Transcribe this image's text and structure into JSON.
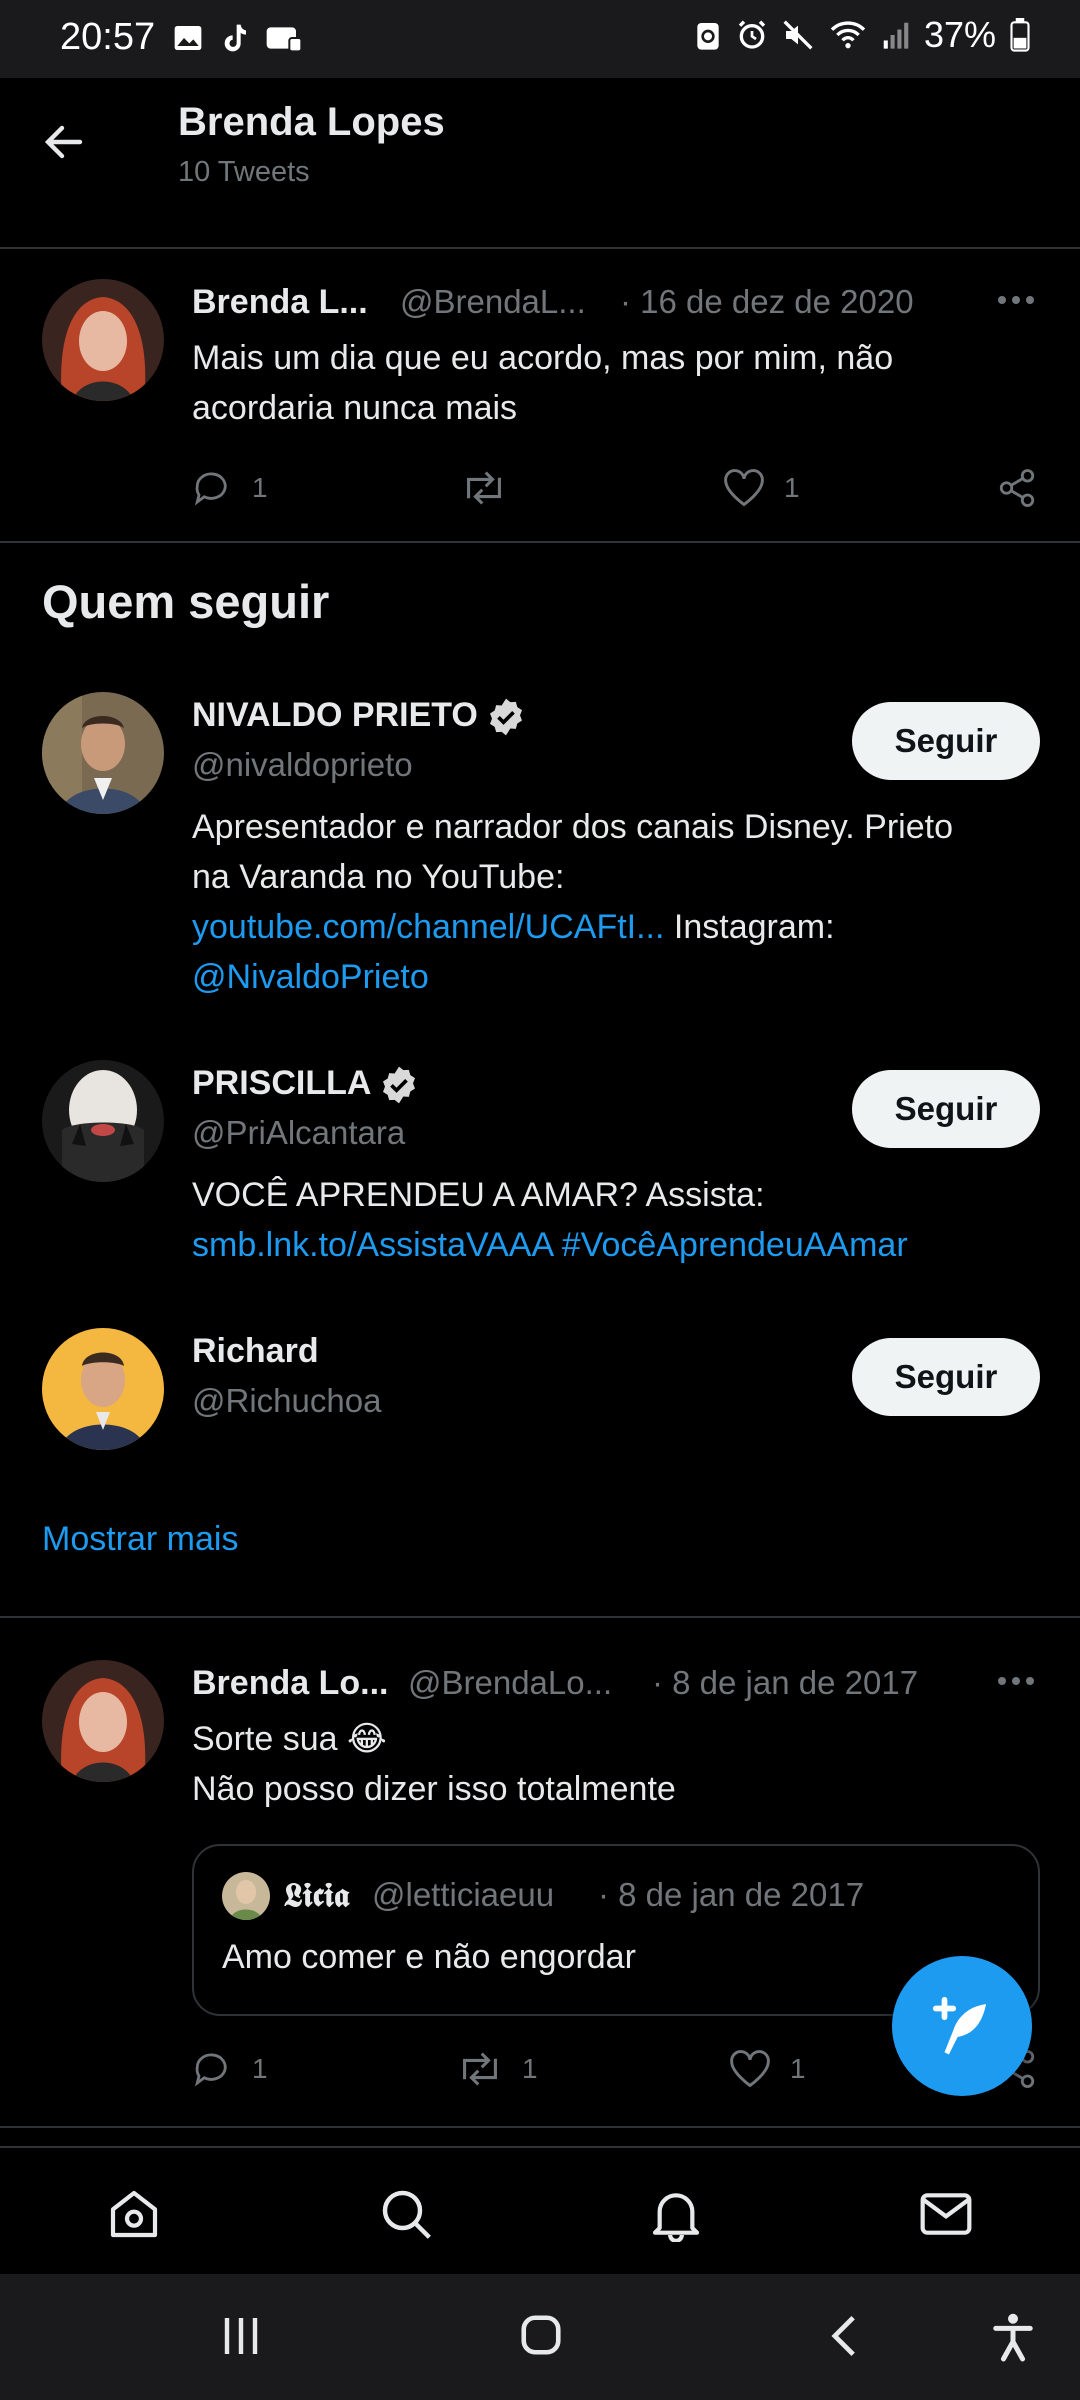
{
  "status": {
    "time": "20:57",
    "battery": "37%"
  },
  "header": {
    "title": "Brenda Lopes",
    "subtitle": "10 Tweets"
  },
  "tweet1": {
    "name": "Brenda L...",
    "handle": "@BrendaL...",
    "date": "· 16 de dez de 2020",
    "text_line1": "Mais um dia que eu acordo, mas por mim, não",
    "text_line2": "acordaria nunca mais",
    "reply_count": "1",
    "retweet_count": "",
    "like_count": "1"
  },
  "who_to_follow": {
    "title": "Quem seguir",
    "follow_label": "Seguir",
    "show_more": "Mostrar mais",
    "accounts": [
      {
        "name": "NIVALDO PRIETO",
        "handle": "@nivaldoprieto",
        "bio_line1": "Apresentador e narrador dos canais Disney. Prieto",
        "bio_line2": "na Varanda no YouTube:",
        "bio_link": "youtube.com/channel/UCAFtI...",
        "bio_after_link": " Instagram:",
        "bio_mention": "@NivaldoPrieto"
      },
      {
        "name": "PRISCILLA",
        "handle": "@PriAlcantara",
        "bio_line1": "VOCÊ APRENDEU A AMAR? Assista:",
        "bio_link": "smb.lnk.to/AssistaVAAA",
        "bio_hashtag": " #VocêAprendeuAAmar"
      },
      {
        "name": "Richard",
        "handle": "@Richuchoa"
      }
    ]
  },
  "tweet2": {
    "name": "Brenda Lo...",
    "handle": "@BrendaLo...",
    "date": "· 8 de jan de 2017",
    "text_line1": "Sorte sua 😂",
    "text_line2": "Não posso dizer isso totalmente",
    "quote": {
      "name": "𝕷𝖎𝖈𝖎𝖆",
      "handle": "@letticiaeuu",
      "date": "· 8 de jan de 2017",
      "text": "Amo comer e não engordar"
    },
    "reply_count": "1",
    "retweet_count": "1",
    "like_count": "1"
  },
  "colors": {
    "accent": "#1d9bf0",
    "background": "#000000",
    "muted": "#71767b"
  }
}
